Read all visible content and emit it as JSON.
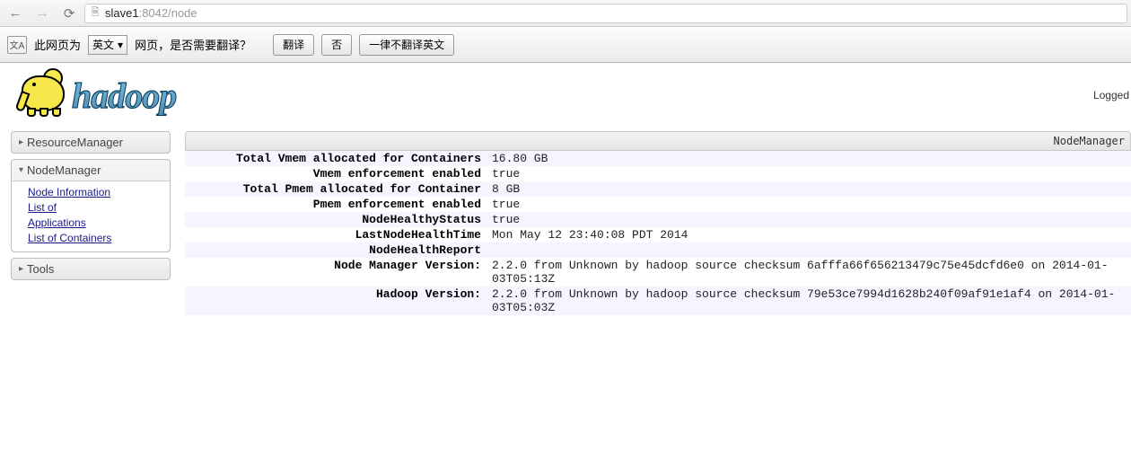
{
  "browser": {
    "url_host": "slave1",
    "url_rest": ":8042/node"
  },
  "translate": {
    "prefix": "此网页为",
    "lang": "英文",
    "suffix": "网页，是否需要翻译？",
    "btn_translate": "翻译",
    "btn_no": "否",
    "btn_never": "一律不翻译英文"
  },
  "header": {
    "logo_text": "hadoop",
    "logged": "Logged"
  },
  "sidebar": {
    "rm": {
      "label": "ResourceManager"
    },
    "nm": {
      "label": "NodeManager",
      "links": {
        "info": "Node Information",
        "apps1": "List of",
        "apps2": "Applications",
        "containers": "List of Containers"
      }
    },
    "tools": {
      "label": "Tools"
    }
  },
  "panel": {
    "title": "NodeManager"
  },
  "rows": [
    {
      "label": "Total Vmem allocated for Containers",
      "value": "16.80 GB"
    },
    {
      "label": "Vmem enforcement enabled",
      "value": "true"
    },
    {
      "label": "Total Pmem allocated for Container",
      "value": "8 GB"
    },
    {
      "label": "Pmem enforcement enabled",
      "value": "true"
    },
    {
      "label": "NodeHealthyStatus",
      "value": "true"
    },
    {
      "label": "LastNodeHealthTime",
      "value": "Mon May 12 23:40:08 PDT 2014"
    },
    {
      "label": "NodeHealthReport",
      "value": ""
    },
    {
      "label": "Node Manager Version:",
      "value": "2.2.0 from Unknown by hadoop source checksum 6afffa66f656213479c75e45dcfd6e0 on 2014-01-03T05:13Z"
    },
    {
      "label": "Hadoop Version:",
      "value": "2.2.0 from Unknown by hadoop source checksum 79e53ce7994d1628b240f09af91e1af4 on 2014-01-03T05:03Z"
    }
  ]
}
